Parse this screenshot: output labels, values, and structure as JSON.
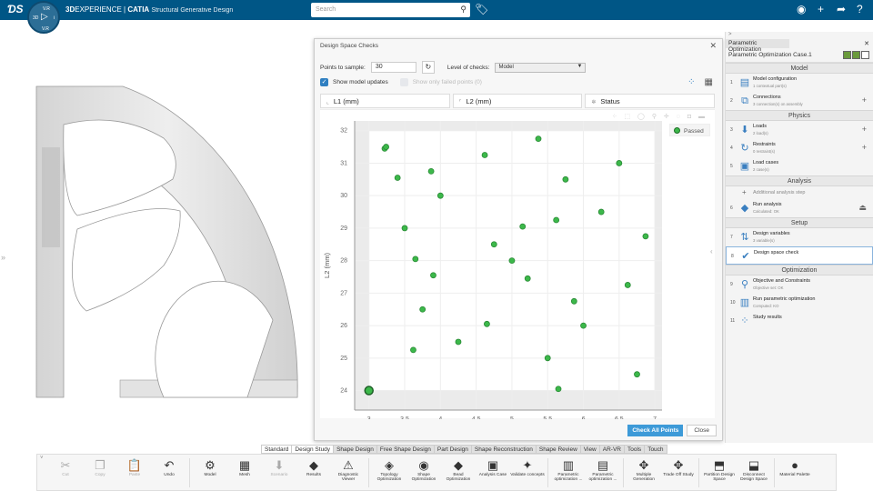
{
  "header": {
    "brand_bold": "3D",
    "brand": "EXPERIENCE",
    "separator": " | ",
    "app": "CATIA",
    "app_sub": "Structural Generative Design",
    "compass": {
      "top": "V.R",
      "left": "3D",
      "right": "i",
      "bottom": "V.R"
    },
    "search_placeholder": "Search"
  },
  "dialog": {
    "title": "Design Space Checks",
    "points_label": "Points to sample:",
    "points_value": "30",
    "level_label": "Level of checks:",
    "level_value": "Model",
    "show_updates": "Show model updates",
    "show_updates_checked": true,
    "show_failed": "Show only failed points (0)",
    "show_failed_checked": false,
    "axis_fields": [
      {
        "icon": "axis-x-icon",
        "label": "L1 (mm)"
      },
      {
        "icon": "axis-y-icon",
        "label": "L2 (mm)"
      },
      {
        "icon": "status-icon",
        "label": "Status"
      }
    ],
    "check_all": "Check All Points",
    "close": "Close"
  },
  "chart_data": {
    "type": "scatter",
    "xlabel": "L1 (mm)",
    "ylabel": "L2 (mm)",
    "xlim": [
      2.8,
      7.1
    ],
    "ylim": [
      23.4,
      32.3
    ],
    "xticks": [
      "3",
      "3.5",
      "4",
      "4.5",
      "5",
      "5.5",
      "6",
      "6.5",
      "7"
    ],
    "yticks": [
      "24",
      "25",
      "26",
      "27",
      "28",
      "29",
      "30",
      "31",
      "32"
    ],
    "grid": true,
    "legend": {
      "position": "top-right",
      "entries": [
        "Passed"
      ]
    },
    "color": "#3cb84a",
    "points": [
      [
        3.0,
        24.0
      ],
      [
        3.22,
        31.45
      ],
      [
        3.24,
        31.5
      ],
      [
        3.4,
        30.55
      ],
      [
        3.87,
        30.75
      ],
      [
        4.0,
        30.0
      ],
      [
        3.5,
        29.0
      ],
      [
        3.65,
        28.05
      ],
      [
        3.9,
        27.55
      ],
      [
        3.75,
        26.5
      ],
      [
        3.62,
        25.25
      ],
      [
        4.25,
        25.5
      ],
      [
        4.65,
        26.05
      ],
      [
        4.62,
        31.25
      ],
      [
        4.75,
        28.5
      ],
      [
        5.0,
        28.0
      ],
      [
        5.15,
        29.05
      ],
      [
        5.22,
        27.45
      ],
      [
        5.37,
        31.75
      ],
      [
        5.62,
        29.25
      ],
      [
        5.75,
        30.5
      ],
      [
        5.87,
        26.75
      ],
      [
        6.0,
        26.0
      ],
      [
        6.25,
        29.5
      ],
      [
        6.5,
        31.0
      ],
      [
        6.62,
        27.25
      ],
      [
        6.87,
        28.75
      ],
      [
        5.5,
        25.0
      ],
      [
        5.65,
        24.05
      ],
      [
        6.75,
        24.5
      ]
    ]
  },
  "panel": {
    "top": ">",
    "title": "Parametric Optimization",
    "case": "Parametric Optimization Case.1",
    "sections": [
      {
        "name": "Model",
        "items": [
          {
            "n": "1",
            "icon": "model-config-icon",
            "glyph": "▤",
            "label": "Model configuration",
            "sub": "1 contextual part(s)"
          },
          {
            "n": "2",
            "icon": "connections-icon",
            "glyph": "⧉",
            "label": "Connections",
            "sub": "3 connection(s) on assembly",
            "plus": "+"
          }
        ]
      },
      {
        "name": "Physics",
        "items": [
          {
            "n": "3",
            "icon": "loads-icon",
            "glyph": "⬇",
            "label": "Loads",
            "sub": "2 load(s)",
            "plus": "+"
          },
          {
            "n": "4",
            "icon": "restraints-icon",
            "glyph": "↻",
            "label": "Restraints",
            "sub": "0 restraint(s)",
            "plus": "+"
          },
          {
            "n": "5",
            "icon": "load-cases-icon",
            "glyph": "▣",
            "label": "Load cases",
            "sub": "2 case(s)"
          }
        ]
      },
      {
        "name": "Analysis",
        "extra": "Additional analysis step",
        "items": [
          {
            "n": "6",
            "icon": "run-analysis-icon",
            "glyph": "◆",
            "label": "Run analysis",
            "sub": "Calculated: OK",
            "plus": "⏏"
          }
        ]
      },
      {
        "name": "Setup",
        "items": [
          {
            "n": "7",
            "icon": "design-variables-icon",
            "glyph": "⇅",
            "label": "Design variables",
            "sub": "3 variable(s)"
          },
          {
            "n": "8",
            "icon": "design-space-check-icon",
            "glyph": "✔",
            "label": "Design space check",
            "sub": "",
            "selected": true
          }
        ]
      },
      {
        "name": "Optimization",
        "items": [
          {
            "n": "9",
            "icon": "objective-icon",
            "glyph": "⚲",
            "label": "Objective and Constraints",
            "sub": "Objective set: OK"
          },
          {
            "n": "10",
            "icon": "run-optimization-icon",
            "glyph": "▥",
            "label": "Run parametric optimization",
            "sub": "Computed: KO"
          },
          {
            "n": "11",
            "icon": "study-results-icon",
            "glyph": "⁘",
            "label": "Study results",
            "sub": ""
          }
        ]
      }
    ]
  },
  "tabs": [
    "Standard",
    "Design Study",
    "Shape Design",
    "Free Shape Design",
    "Part Design",
    "Shape Reconstruction",
    "Shape Review",
    "View",
    "AR-VR",
    "Tools",
    "Touch"
  ],
  "toolbar": [
    {
      "label": "Cut",
      "glyph": "✂",
      "dis": true
    },
    {
      "label": "Copy",
      "glyph": "❐",
      "dis": true
    },
    {
      "label": "Paste",
      "glyph": "📋",
      "dis": true
    },
    {
      "label": "Undo",
      "glyph": "↶"
    },
    {
      "sep": true
    },
    {
      "label": "Model",
      "glyph": "⚙"
    },
    {
      "label": "Mesh",
      "glyph": "▦"
    },
    {
      "label": "Scenario",
      "glyph": "⬇",
      "dis": true
    },
    {
      "label": "Results",
      "glyph": "◆"
    },
    {
      "label": "Diagnostic Viewer",
      "glyph": "⚠"
    },
    {
      "sep": true
    },
    {
      "label": "Topology Optimization",
      "glyph": "◈"
    },
    {
      "label": "Shape Optimization",
      "glyph": "◉"
    },
    {
      "label": "Bead Optimization",
      "glyph": "◆"
    },
    {
      "label": "Analysis Case",
      "glyph": "▣"
    },
    {
      "label": "Validate concepts",
      "glyph": "✦"
    },
    {
      "sep": true
    },
    {
      "label": "Parametric optimization ...",
      "glyph": "▥"
    },
    {
      "label": "Parametric optimization ...",
      "glyph": "▤"
    },
    {
      "sep": true
    },
    {
      "label": "Multiple Generation",
      "glyph": "✥"
    },
    {
      "label": "Trade Off Study",
      "glyph": "✥"
    },
    {
      "sep": true
    },
    {
      "label": "Partition Design Space",
      "glyph": "⬒"
    },
    {
      "label": "Disconnect Design Space",
      "glyph": "⬓"
    },
    {
      "sep": true
    },
    {
      "label": "Material Palette",
      "glyph": "●"
    }
  ]
}
